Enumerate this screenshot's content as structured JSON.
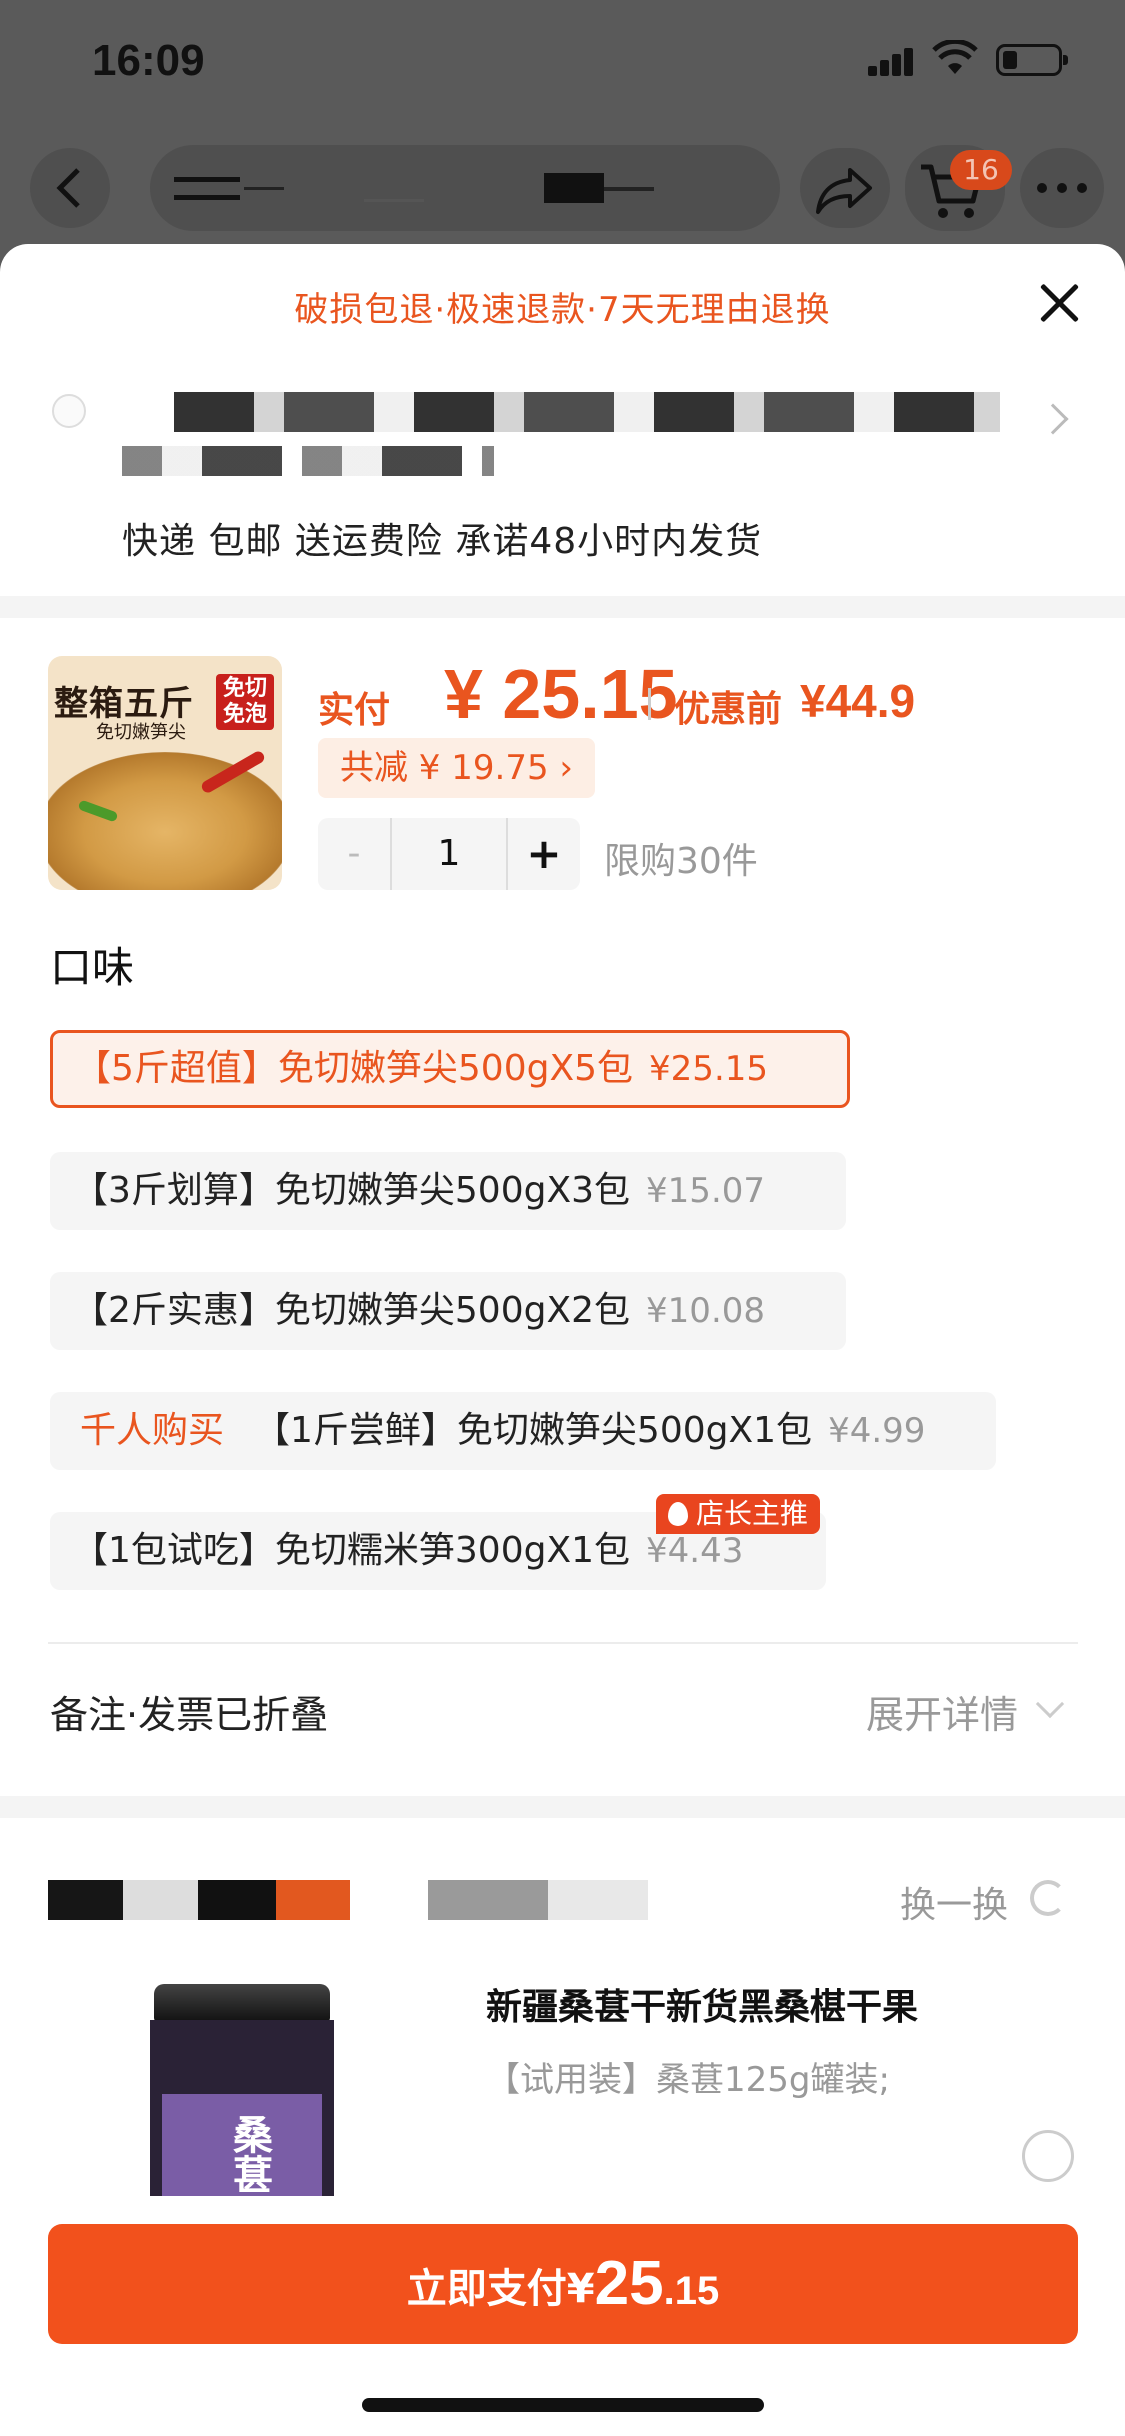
{
  "status_bar": {
    "time": "16:09"
  },
  "nav": {
    "cart_count": "16"
  },
  "sheet": {
    "promise_text": "破损包退·极速退款·7天无理由退换",
    "shipping_text": "快递 包邮 送运费险 承诺48小时内发货"
  },
  "product": {
    "thumb_title": "整箱五斤",
    "thumb_subtitle": "免切嫩笋尖",
    "thumb_badge": "免切免泡",
    "paid_label": "实付",
    "paid_price": "¥ 25.15",
    "before_label": "优惠前",
    "before_price": "¥44.9",
    "discount_text": "共减 ¥ 19.75 ›",
    "quantity": "1",
    "minus_label": "-",
    "plus_label": "+",
    "limit_text": "限购30件"
  },
  "flavor": {
    "title": "口味",
    "options": [
      {
        "name": "【5斤超值】免切嫩笋尖500gX5包",
        "price": "¥25.15",
        "selected": true
      },
      {
        "name": "【3斤划算】免切嫩笋尖500gX3包",
        "price": "¥15.07"
      },
      {
        "name": "【2斤实惠】免切嫩笋尖500gX2包",
        "price": "¥10.08"
      },
      {
        "tag": "千人购买",
        "name": "【1斤尝鲜】免切嫩笋尖500gX1包",
        "price": "¥4.99"
      },
      {
        "name": "【1包试吃】免切糯米笋300gX1包",
        "price": "¥4.43",
        "badge": "店长主推"
      }
    ]
  },
  "notes": {
    "label": "备注·发票已折叠",
    "expand": "展开详情"
  },
  "recommend": {
    "swap_label": "换一换",
    "jar_label": "桑葚",
    "title": "新疆桑葚干新货黑桑椹干果",
    "subtitle": "【试用装】桑葚125g罐装;"
  },
  "pay": {
    "label": "立即支付¥",
    "amount_int": "25",
    "amount_dec": ".15"
  },
  "colors": {
    "accent": "#f2511c",
    "accent_text": "#e9551f"
  }
}
